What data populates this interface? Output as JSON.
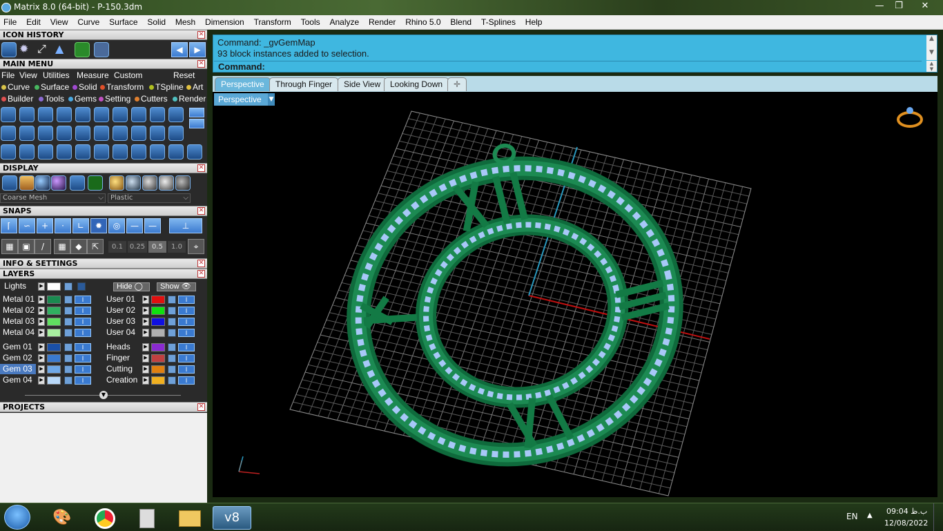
{
  "window": {
    "title": "Matrix 8.0 (64-bit) - P-150.3dm"
  },
  "menubar": {
    "items": [
      "File",
      "Edit",
      "View",
      "Curve",
      "Surface",
      "Solid",
      "Mesh",
      "Dimension",
      "Transform",
      "Tools",
      "Analyze",
      "Render",
      "Rhino 5.0",
      "Blend",
      "T-Splines",
      "Help"
    ]
  },
  "panels": {
    "icon_history": "ICON HISTORY",
    "main_menu": "MAIN MENU",
    "display": "DISPLAY",
    "snaps": "SNAPS",
    "info": "INFO & SETTINGS",
    "layers": "LAYERS",
    "projects": "PROJECTS"
  },
  "main_menu": {
    "row1": [
      "File",
      "View",
      "Utilities",
      "Measure",
      "Custom"
    ],
    "reset": "Reset",
    "row2": [
      {
        "label": "Curve",
        "color": "#d8c34a"
      },
      {
        "label": "Surface",
        "color": "#48b860"
      },
      {
        "label": "Solid",
        "color": "#a04ad0"
      },
      {
        "label": "Transform",
        "color": "#e0502a"
      },
      {
        "label": "TSpline",
        "color": "#b0c020"
      },
      {
        "label": "Art",
        "color": "#e0c040"
      }
    ],
    "row3": [
      {
        "label": "Builder",
        "color": "#e05050"
      },
      {
        "label": "Tools",
        "color": "#8a6ad0"
      },
      {
        "label": "Gems",
        "color": "#4aa8e0"
      },
      {
        "label": "Setting",
        "color": "#c050c0"
      },
      {
        "label": "Cutters",
        "color": "#e08030"
      },
      {
        "label": "Render",
        "color": "#50c0c0"
      }
    ]
  },
  "display": {
    "mesh_select": "Coarse Mesh",
    "material_select": "Plastic"
  },
  "snaps": {
    "values": [
      "0.1",
      "0.25",
      "0.5",
      "1.0"
    ]
  },
  "layers": {
    "lights": "Lights",
    "hide": "Hide",
    "show": "Show",
    "left": [
      {
        "name": "Metal 01",
        "color": "#1a8a50"
      },
      {
        "name": "Metal 02",
        "color": "#30b060"
      },
      {
        "name": "Metal 03",
        "color": "#60e060"
      },
      {
        "name": "Metal 04",
        "color": "#a8f0a0"
      },
      {
        "name": "Gem 01",
        "color": "#1a50a8"
      },
      {
        "name": "Gem 02",
        "color": "#3a7ad0"
      },
      {
        "name": "Gem 03",
        "color": "#6ea8e8"
      },
      {
        "name": "Gem 04",
        "color": "#b8d8f8"
      }
    ],
    "right": [
      {
        "name": "User 01",
        "color": "#e01010"
      },
      {
        "name": "User 02",
        "color": "#10e010"
      },
      {
        "name": "User 03",
        "color": "#1010e0"
      },
      {
        "name": "User 04",
        "color": "#b0b0b0"
      },
      {
        "name": "Heads",
        "color": "#8a2ad0"
      },
      {
        "name": "Finger",
        "color": "#c04040"
      },
      {
        "name": "Cutting",
        "color": "#e08010"
      },
      {
        "name": "Creation",
        "color": "#f0b020"
      }
    ]
  },
  "command": {
    "line1": "Command: _gvGemMap",
    "line2": "93 block instances added to selection.",
    "prompt": "Command:"
  },
  "viewport_tabs": [
    "Perspective",
    "Through Finger",
    "Side View",
    "Looking Down"
  ],
  "viewport": {
    "label": "Perspective"
  },
  "taskbar": {
    "lang": "EN",
    "time": "09:04 ب.ظ",
    "date": "12/08/2022"
  }
}
